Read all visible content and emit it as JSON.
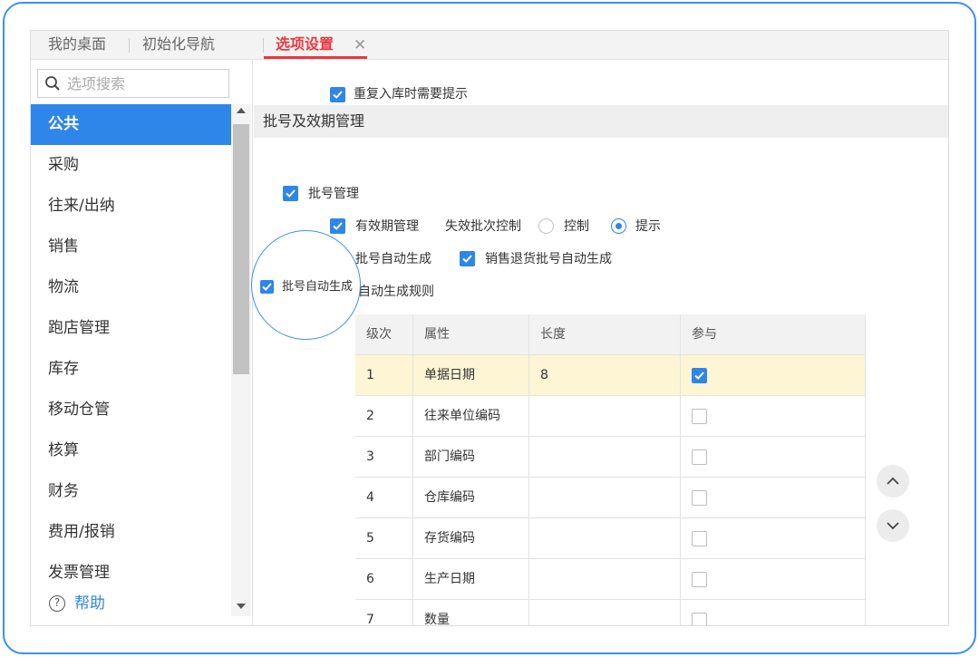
{
  "tabs": [
    {
      "label": "我的桌面"
    },
    {
      "label": "初始化导航"
    },
    {
      "label": "选项设置"
    }
  ],
  "tab_close_glyph": "✕",
  "search": {
    "placeholder": "选项搜索",
    "value": ""
  },
  "sidebar": {
    "items": [
      {
        "label": "公共"
      },
      {
        "label": "采购"
      },
      {
        "label": "往来/出纳"
      },
      {
        "label": "销售"
      },
      {
        "label": "物流"
      },
      {
        "label": "跑店管理"
      },
      {
        "label": "库存"
      },
      {
        "label": "移动仓管"
      },
      {
        "label": "核算"
      },
      {
        "label": "财务"
      },
      {
        "label": "费用/报销"
      },
      {
        "label": "发票管理"
      }
    ],
    "help_label": "帮助",
    "help_glyph": "?"
  },
  "main": {
    "top_partial_label": "重复入库时需要提示",
    "section_title": "批号及效期管理",
    "batch_mgmt": "批号管理",
    "expiry_mgmt": "有效期管理",
    "invalid_batch_control": "失效批次控制",
    "radio_control": "控制",
    "radio_hint": "提示",
    "batch_auto_gen": "批号自动生成",
    "sales_return_auto_gen": "销售退货批号自动生成",
    "rule_label": "自动生成规则"
  },
  "magnifier": {
    "label": "批号自动生成"
  },
  "table": {
    "headers": [
      "级次",
      "属性",
      "长度",
      "参与"
    ],
    "rows": [
      {
        "level": "1",
        "attr": "单据日期",
        "length": "8",
        "checked": true
      },
      {
        "level": "2",
        "attr": "往来单位编码",
        "length": "",
        "checked": false
      },
      {
        "level": "3",
        "attr": "部门编码",
        "length": "",
        "checked": false
      },
      {
        "level": "4",
        "attr": "仓库编码",
        "length": "",
        "checked": false
      },
      {
        "level": "5",
        "attr": "存货编码",
        "length": "",
        "checked": false
      },
      {
        "level": "6",
        "attr": "生产日期",
        "length": "",
        "checked": false
      },
      {
        "level": "7",
        "attr": "数量",
        "length": "",
        "checked": false
      }
    ]
  },
  "colors": {
    "accent": "#2f86ea",
    "active_tab": "#e8383d",
    "highlight_row": "#fdf5d4"
  }
}
